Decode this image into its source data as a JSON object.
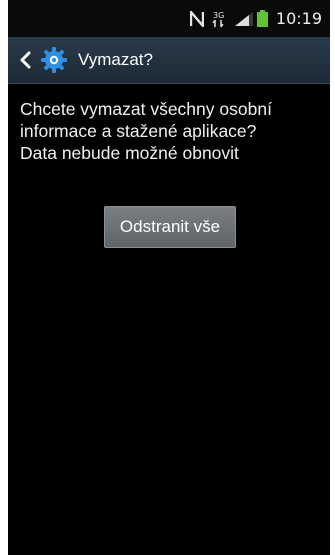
{
  "status_bar": {
    "time": "10:19",
    "network_type": "3G",
    "icons": [
      "nfc-icon",
      "network-3g-icon",
      "signal-icon",
      "battery-icon"
    ]
  },
  "action_bar": {
    "title": "Vymazat?",
    "back_icon": "back-chevron-icon",
    "app_icon": "settings-gear-icon",
    "accent_color": "#2a3a4a"
  },
  "content": {
    "message": "Chcete vymazat všechny osobní\ninformace a stažené aplikace?\nData nebude možné obnovit",
    "button_label": "Odstranit vše"
  }
}
